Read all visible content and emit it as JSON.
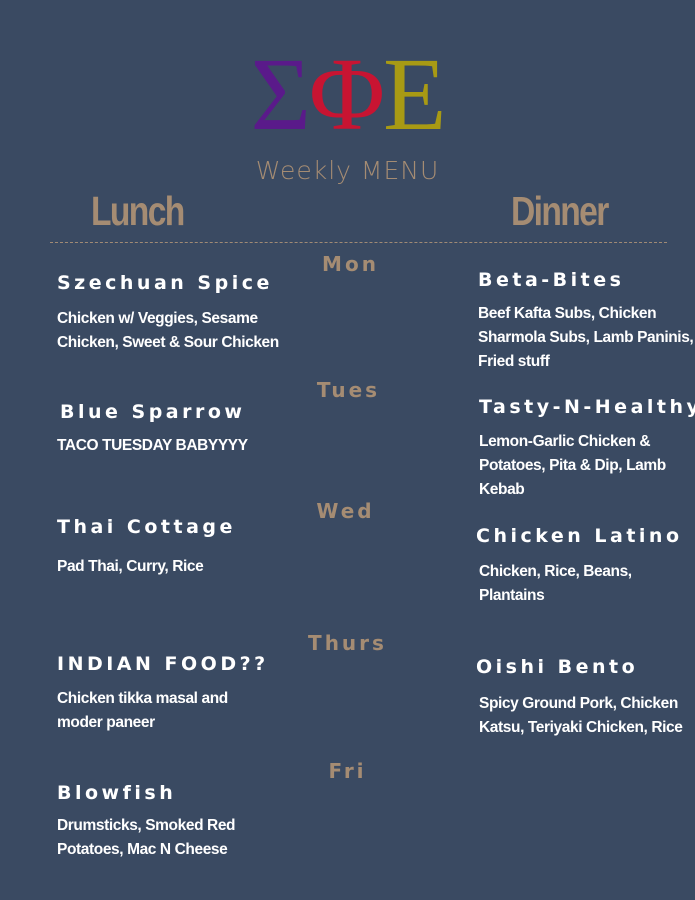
{
  "logo": {
    "letters": [
      "Σ",
      "Φ",
      "Ε"
    ],
    "colors": [
      "#5a1a8a",
      "#c81432",
      "#a89a14"
    ]
  },
  "title": "Weekly MENU",
  "columns": {
    "lunch": "Lunch",
    "dinner": "Dinner"
  },
  "days": [
    {
      "day": "Mon",
      "lunch": {
        "place": "Szechuan Spice",
        "items": [
          "Chicken w/ Veggies, Sesame",
          "Chicken, Sweet & Sour Chicken"
        ]
      },
      "dinner": {
        "place": "Beta-Bites",
        "items": [
          "Beef Kafta Subs, Chicken",
          "Sharmola Subs, Lamb Paninis,",
          "Fried stuff"
        ]
      }
    },
    {
      "day": "Tues",
      "lunch": {
        "place": "Blue Sparrow",
        "items": [
          "TACO TUESDAY BABYYYY"
        ]
      },
      "dinner": {
        "place": "Tasty-N-Healthy",
        "items": [
          "Lemon-Garlic Chicken &",
          "Potatoes, Pita & Dip, Lamb",
          "Kebab"
        ]
      }
    },
    {
      "day": "Wed",
      "lunch": {
        "place": "Thai Cottage",
        "items": [
          "Pad Thai, Curry, Rice"
        ]
      },
      "dinner": {
        "place": "Chicken Latino",
        "items": [
          "Chicken, Rice, Beans,",
          "Plantains"
        ]
      }
    },
    {
      "day": "Thurs",
      "lunch": {
        "place": "INDIAN FOOD??",
        "items": [
          "Chicken tikka masal and",
          "moder paneer"
        ]
      },
      "dinner": {
        "place": "Oishi Bento",
        "items": [
          "Spicy Ground Pork, Chicken",
          "Katsu, Teriyaki Chicken, Rice"
        ]
      }
    },
    {
      "day": "Fri",
      "lunch": {
        "place": "Blowfish",
        "items": [
          "Drumsticks, Smoked Red",
          "Potatoes, Mac N Cheese"
        ]
      },
      "dinner": null
    }
  ]
}
